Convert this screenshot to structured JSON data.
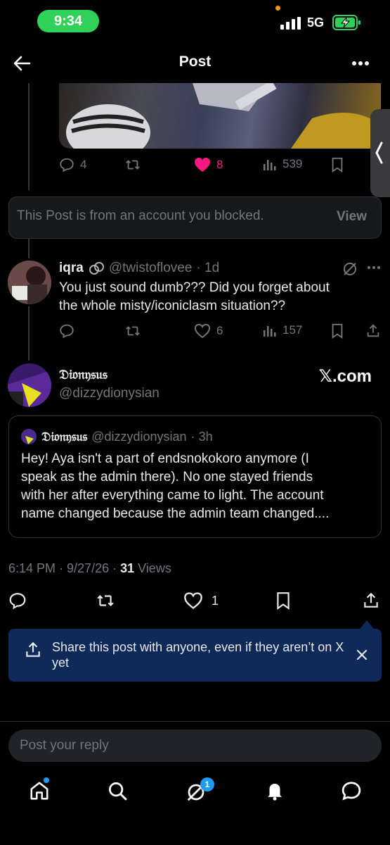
{
  "status_bar": {
    "time": "9:34",
    "network": "5G"
  },
  "header": {
    "title": "Post"
  },
  "post1": {
    "replies": "4",
    "likes": "8",
    "views": "539"
  },
  "blocked": {
    "text": "This Post is from an account you blocked.",
    "view_label": "View"
  },
  "reply": {
    "name": "iqra",
    "handle": "@twistoflovee",
    "time": "· 1d",
    "text_line1": "You just sound dumb???  Did you forget about",
    "text_line2": "the whole misty/iconiclasm situation??",
    "likes": "6",
    "views": "157"
  },
  "main": {
    "name": "𝔇𝔦𝔬𝔫𝔶𝔰𝔲𝔰",
    "handle": "@dizzydionysian",
    "source": "𝕏.com",
    "quote": {
      "name": "𝔇𝔦𝔬𝔫𝔶𝔰𝔲𝔰",
      "handle": "@dizzydionysian",
      "time": "· 3h",
      "line1": "Hey! Aya isn't a part of endsnokokoro anymore (I",
      "line2": "speak as the admin there). No one stayed friends",
      "line3": "with her after everything came to light. The account",
      "line4": "name changed because the admin team changed...."
    },
    "meta_time": "6:14 PM · 9/27/26 · ",
    "meta_views": "31",
    "meta_views_label": " Views",
    "likes": "1"
  },
  "toast": {
    "text": "Share this post with anyone, even if they aren’t on X yet"
  },
  "composer": {
    "placeholder": "Post your reply"
  },
  "tabbar": {
    "messages_badge": "1"
  },
  "colors": {
    "accent": "#1d9bf0",
    "like": "#f91880",
    "toast_bg": "#0f2a59",
    "status_pill": "#30d158"
  }
}
